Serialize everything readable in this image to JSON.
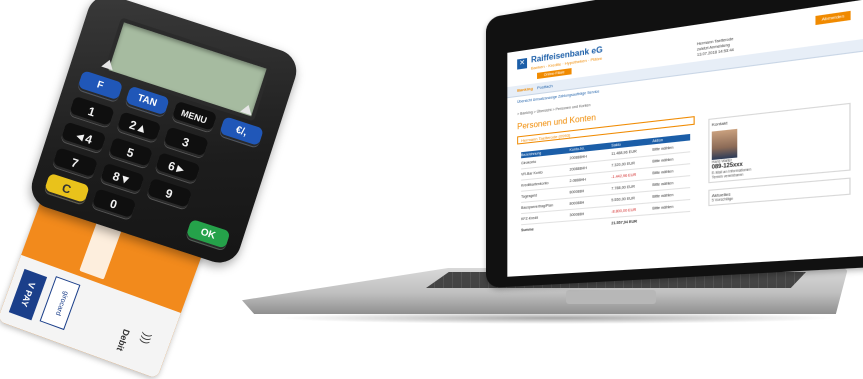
{
  "reader": {
    "keys": [
      "F",
      "TAN",
      "MENU",
      "€/,",
      "1",
      "2▲",
      "3",
      "",
      "◄4",
      "5",
      "6►",
      "",
      "7",
      "8▼",
      "9",
      "",
      "C",
      "0",
      "",
      "OK"
    ]
  },
  "card": {
    "vpay": "V PAY",
    "girocard": "girocard",
    "debit": "Debit"
  },
  "bank": {
    "name": "Raiffeisenbank eG",
    "claim": "Banken · Kredite · Hypotheken · Plätze",
    "orange_button": "Abmelden",
    "orange_bar": "Online-Filiale",
    "user_lines": [
      "Hermann Taelterode",
      "zuletzt Anmeldung",
      "13.07.2018 14:53:44"
    ],
    "nav_tabs": [
      "Banking",
      "Postfach"
    ],
    "subnav": "Übersicht   Umsatzanzeige   Zahlungsaufträge   Service",
    "crumbs": "> Banking > Übersicht > Personen und Konten",
    "page_title": "Personen und Konten",
    "owner": "Hermann Taelterode (0993)",
    "table": {
      "headers": [
        "Bezeichnung",
        "Konto-Nr.",
        "Saldo",
        "Aktion"
      ],
      "rows": [
        [
          "Girokonto",
          "200888HH",
          "11.488,96 EUR",
          "Bitte wählen"
        ],
        [
          "VR-Bar Konto",
          "200888HH",
          "7.320,00 EUR",
          "Bitte wählen"
        ],
        [
          "Kreditkartenkonto",
          "2-0888HH",
          "-1.442,96 EUR",
          "Bitte wählen"
        ],
        [
          "Tagesgeld",
          "800088H",
          "7.788,00 EUR",
          "Bitte wählen"
        ],
        [
          "Bausparvertrag/Plan",
          "800088H",
          "5.550,00 EUR",
          "Bitte wählen"
        ],
        [
          "KFZ-Kredit",
          "300088H",
          "-8.800,00 EUR",
          "Bitte wählen"
        ],
        [
          "Summe",
          "",
          "21.557,94 EUR",
          ""
        ]
      ],
      "negative_rows": [
        2,
        5
      ]
    },
    "side": {
      "kontakt_title": "Kontakt",
      "advisor_name": "Hans Walter",
      "advisor_phone": "089-125xxx",
      "advisor_lines": [
        "E-Mail an Informationen",
        "Termin vereinbaren"
      ],
      "aktuelles_title": "Aktuelles",
      "aktuelles_line": "5 Vorschläge"
    }
  },
  "colors": {
    "bank_blue": "#1b5ea8",
    "bank_orange": "#f08a00",
    "card_orange": "#f28a1c",
    "reader_key_blue": "#2057b8",
    "reader_key_yellow": "#e9c21b",
    "reader_key_green": "#25a24a"
  }
}
